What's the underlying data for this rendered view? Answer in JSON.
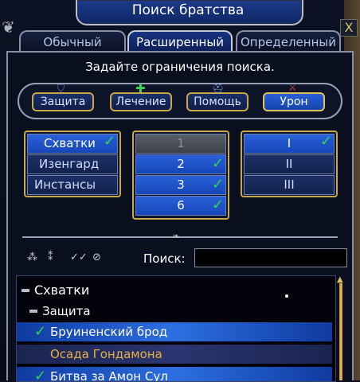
{
  "window": {
    "title": "Поиск братства",
    "close_label": "X"
  },
  "tabs": [
    {
      "label": "Обычный",
      "active": false
    },
    {
      "label": "Расширенный",
      "active": true
    },
    {
      "label": "Определенный",
      "active": false
    }
  ],
  "instruction": "Задайте ограничения поиска.",
  "roles": [
    {
      "label": "Защита",
      "selected": false,
      "icon": "shield-icon"
    },
    {
      "label": "Лечение",
      "selected": false,
      "icon": "plus-icon"
    },
    {
      "label": "Помощь",
      "selected": false,
      "icon": "helmet-icon"
    },
    {
      "label": "Урон",
      "selected": true,
      "icon": "crossed-swords-icon"
    }
  ],
  "types": [
    {
      "label": "Схватки",
      "selected": true,
      "checked": true
    },
    {
      "label": "Изенгард",
      "selected": false,
      "checked": false
    },
    {
      "label": "Инстансы",
      "selected": false,
      "checked": false
    }
  ],
  "sizes": [
    {
      "label": "1",
      "state": "disabled",
      "checked": false
    },
    {
      "label": "2",
      "state": "selected",
      "checked": true
    },
    {
      "label": "3",
      "state": "selected",
      "checked": true
    },
    {
      "label": "6",
      "state": "selected",
      "checked": true
    }
  ],
  "tiers": [
    {
      "label": "I",
      "selected": true,
      "checked": true
    },
    {
      "label": "II",
      "selected": false,
      "checked": false
    },
    {
      "label": "III",
      "selected": false,
      "checked": false
    }
  ],
  "toolbar": {
    "icons": [
      "expand-all-icon",
      "collapse-all-icon",
      "check-all-icon",
      "clear-all-icon"
    ],
    "search_label": "Поиск:",
    "search_value": ""
  },
  "tree": [
    {
      "label": "Схватки",
      "level": 0,
      "kind": "group",
      "checked": false
    },
    {
      "label": "Защита",
      "level": 1,
      "kind": "group",
      "checked": false
    },
    {
      "label": "Бруиненский брод",
      "level": 2,
      "kind": "item",
      "checked": true,
      "highlight": "primary"
    },
    {
      "label": "Осада Гондамона",
      "level": 2,
      "kind": "item",
      "checked": false,
      "highlight": "secondary",
      "color": "#e8b040"
    },
    {
      "label": "Битва за Амон Сул",
      "level": 2,
      "kind": "item",
      "checked": true,
      "highlight": "primary"
    }
  ],
  "colors": {
    "check": "#37d24a",
    "accent_gold": "#c9a84a",
    "selected_blue": "#2a61d8"
  }
}
